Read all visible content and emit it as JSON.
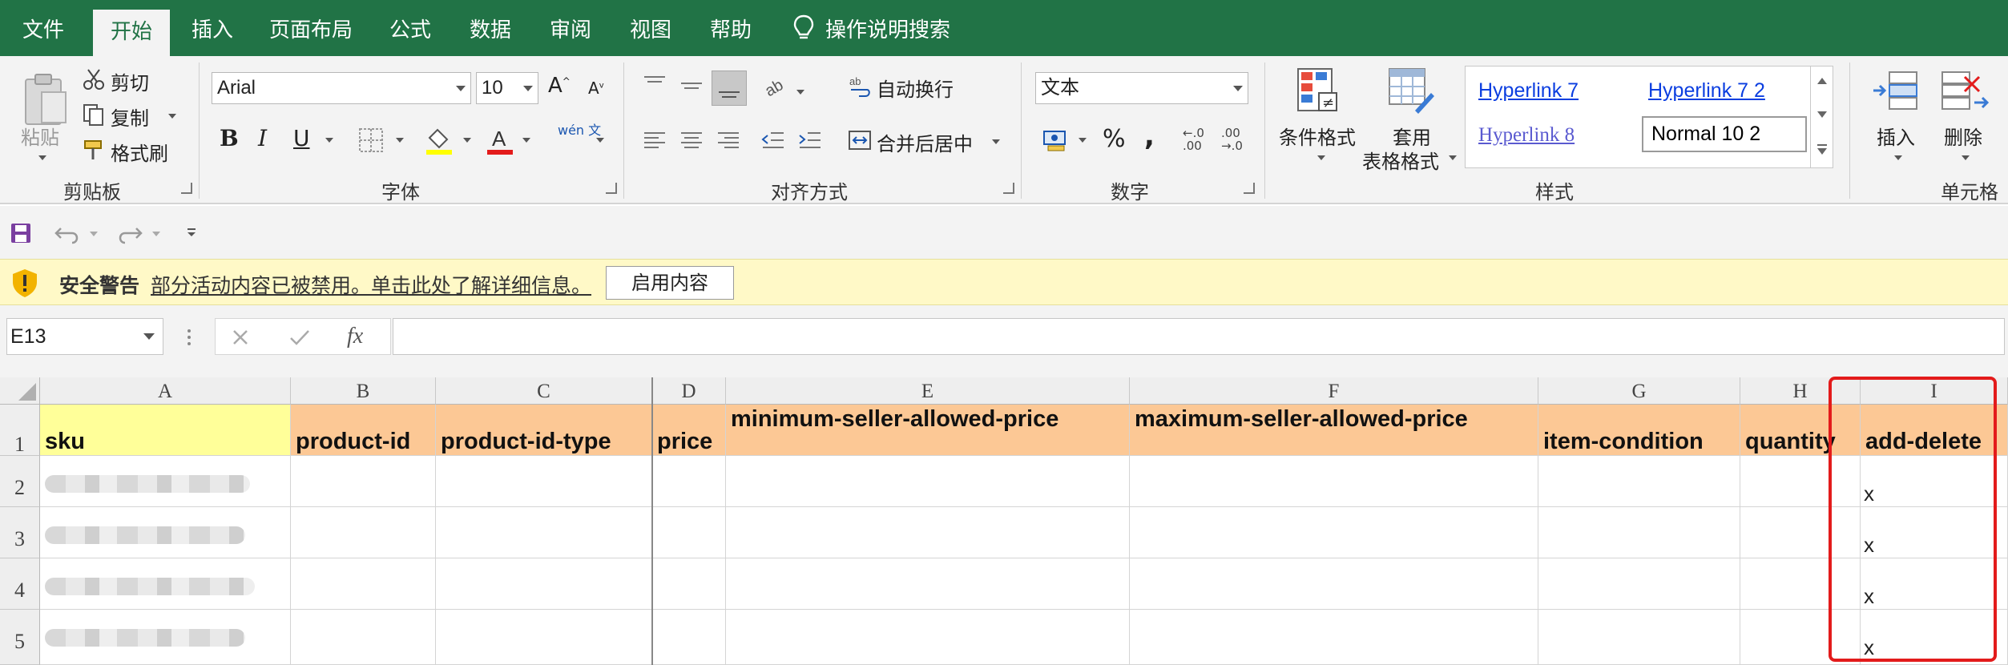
{
  "menu": {
    "tabs": [
      "文件",
      "开始",
      "插入",
      "页面布局",
      "公式",
      "数据",
      "审阅",
      "视图",
      "帮助"
    ],
    "active_tab": "开始",
    "tell_me": "操作说明搜索"
  },
  "ribbon": {
    "clipboard": {
      "paste": "粘贴",
      "cut": "剪切",
      "copy": "复制",
      "format_painter": "格式刷",
      "label": "剪贴板"
    },
    "font": {
      "name": "Arial",
      "size": "10",
      "bold": "B",
      "italic": "I",
      "underline": "U",
      "label": "字体",
      "phonetic": "wén 文"
    },
    "alignment": {
      "wrap_text": "自动换行",
      "merge_center": "合并后居中",
      "label": "对齐方式"
    },
    "number": {
      "format": "文本",
      "percent": "%",
      "comma": ",",
      "label": "数字"
    },
    "styles": {
      "conditional": "条件格式",
      "table_format_1": "套用",
      "table_format_2": "表格格式",
      "gallery": [
        "Hyperlink 7",
        "Hyperlink 7 2",
        "Hyperlink 8",
        "Normal 10 2"
      ],
      "label": "样式"
    },
    "cells": {
      "insert": "插入",
      "delete": "删除",
      "label": "单元格"
    }
  },
  "security_bar": {
    "title": "安全警告",
    "message": "部分活动内容已被禁用。单击此处了解详细信息。",
    "button": "启用内容"
  },
  "formula_bar": {
    "name_box": "E13",
    "fx": "fx",
    "formula": ""
  },
  "sheet": {
    "columns": [
      "A",
      "B",
      "C",
      "D",
      "E",
      "F",
      "G",
      "H",
      "I"
    ],
    "rows": [
      "1",
      "2",
      "3",
      "4",
      "5"
    ],
    "headers": [
      "sku",
      "product-id",
      "product-id-type",
      "price",
      "minimum-seller-allowed-price",
      "maximum-seller-allowed-price",
      "item-condition",
      "quantity",
      "add-delete"
    ],
    "add_delete_values": [
      "x",
      "x",
      "x",
      "x"
    ]
  },
  "colors": {
    "excel_green": "#217346",
    "header_fill": "#fcc895",
    "sku_fill": "#ffff99",
    "highlight": "#e31b1b",
    "security_bg": "#fff9c7"
  }
}
